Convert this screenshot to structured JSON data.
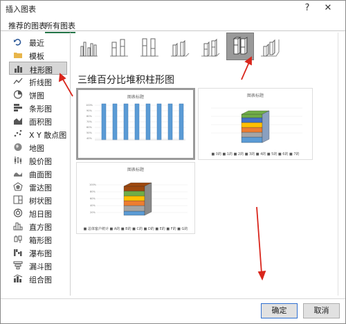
{
  "window": {
    "title": "插入图表",
    "help_label": "?",
    "close_label": "✕"
  },
  "tabs": [
    {
      "label": "推荐的图表"
    },
    {
      "label": "所有图表"
    }
  ],
  "sidebar": {
    "items": [
      {
        "label": "最近",
        "icon": "undo-arrow-icon"
      },
      {
        "label": "模板",
        "icon": "folder-icon"
      },
      {
        "label": "柱形图",
        "icon": "column-chart-icon"
      },
      {
        "label": "折线图",
        "icon": "line-chart-icon"
      },
      {
        "label": "饼图",
        "icon": "pie-chart-icon"
      },
      {
        "label": "条形图",
        "icon": "bar-chart-icon"
      },
      {
        "label": "面积图",
        "icon": "area-chart-icon"
      },
      {
        "label": "X Y 散点图",
        "icon": "scatter-chart-icon"
      },
      {
        "label": "地图",
        "icon": "globe-icon"
      },
      {
        "label": "股价图",
        "icon": "stock-chart-icon"
      },
      {
        "label": "曲面图",
        "icon": "surface-chart-icon"
      },
      {
        "label": "雷达图",
        "icon": "radar-chart-icon"
      },
      {
        "label": "树状图",
        "icon": "treemap-icon"
      },
      {
        "label": "旭日图",
        "icon": "sunburst-icon"
      },
      {
        "label": "直方图",
        "icon": "histogram-icon"
      },
      {
        "label": "箱形图",
        "icon": "boxplot-icon"
      },
      {
        "label": "瀑布图",
        "icon": "waterfall-icon"
      },
      {
        "label": "漏斗图",
        "icon": "funnel-icon"
      },
      {
        "label": "组合图",
        "icon": "combo-chart-icon"
      }
    ],
    "selected_index": 2
  },
  "subtypes": {
    "items": [
      {
        "icon": "clustered-column-icon"
      },
      {
        "icon": "stacked-column-icon"
      },
      {
        "icon": "100-stacked-column-icon"
      },
      {
        "icon": "3d-clustered-column-icon"
      },
      {
        "icon": "3d-stacked-column-icon"
      },
      {
        "icon": "3d-100-stacked-column-icon"
      },
      {
        "icon": "3d-column-icon"
      }
    ],
    "selected_index": 5
  },
  "section_title": "三维百分比堆积柱形图",
  "previews": [
    {
      "title": "图表标题",
      "legend": ""
    },
    {
      "title": "图表标题",
      "legend": "■ 0的 ■ 1的 ■ 2的 ■ 3的 ■ 4的 ■ 5的 ■ 6的 ■ 7的"
    },
    {
      "title": "图表标题",
      "legend": "■ 总体客户统计 ■ A的 ■ B的 ■ C的 ■ D的 ■ E的 ■ F的 ■ G的"
    }
  ],
  "buttons": {
    "ok": "确定",
    "cancel": "取消"
  },
  "colors": {
    "accent": "#217346",
    "arrow": "#d9261c",
    "bar_blue": "#5b9bd5"
  }
}
